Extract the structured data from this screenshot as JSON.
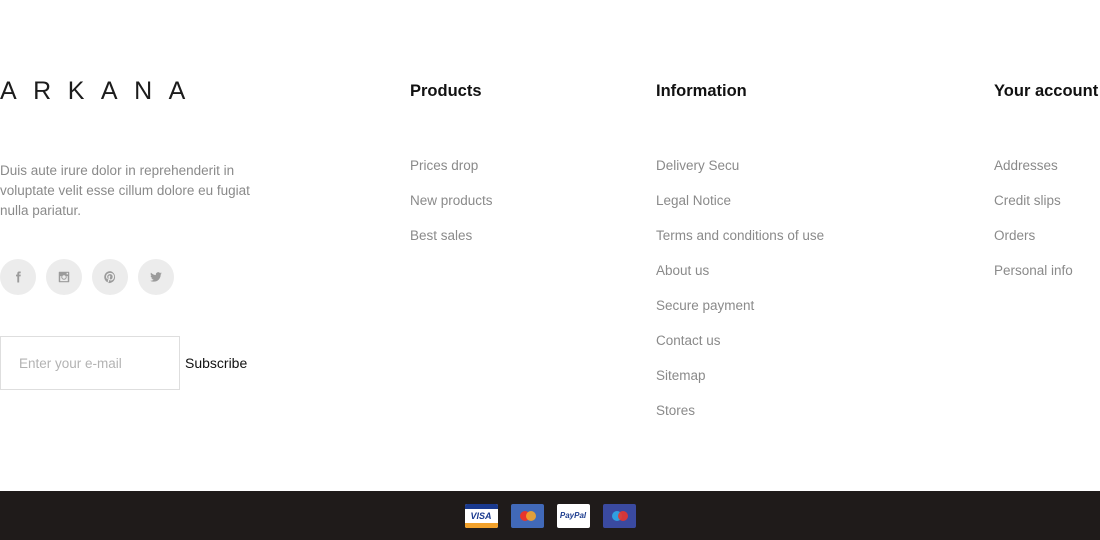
{
  "brand": {
    "logo": "ARKANA",
    "description": "Duis aute irure dolor in reprehenderit in voluptate velit esse cillum dolore eu fugiat nulla pariatur."
  },
  "social": [
    "facebook-icon",
    "instagram-icon",
    "pinterest-icon",
    "twitter-icon"
  ],
  "newsletter": {
    "placeholder": "Enter your e-mail",
    "button_label": "Subscribe"
  },
  "products": {
    "title": "Products",
    "links": [
      "Prices drop",
      "New products",
      "Best sales"
    ]
  },
  "information": {
    "title": "Information",
    "links": [
      "Delivery Secu",
      "Legal Notice",
      "Terms and conditions of use",
      "About us",
      "Secure payment",
      "Contact us",
      "Sitemap",
      "Stores"
    ]
  },
  "account": {
    "title": "Your account",
    "links": [
      "Addresses",
      "Credit slips",
      "Orders",
      "Personal info"
    ]
  },
  "payments": {
    "visa": "VISA",
    "paypal": "PayPal",
    "icons": [
      "visa-icon",
      "mastercard-icon",
      "paypal-icon",
      "maestro-icon"
    ]
  },
  "colors": {
    "bottom_bar": "#1f1b1a",
    "link_text": "#8a8a8a",
    "heading_text": "#111111",
    "social_bg": "#ececec"
  }
}
